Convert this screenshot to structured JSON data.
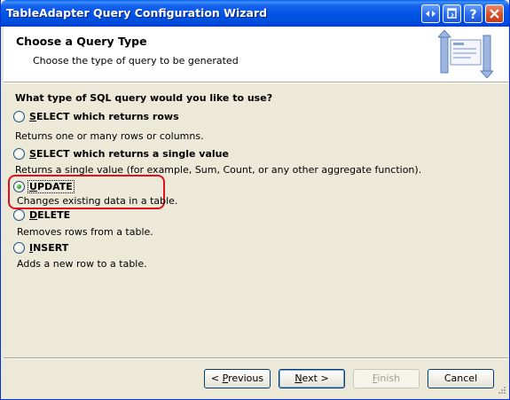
{
  "window": {
    "title": "TableAdapter Query Configuration Wizard"
  },
  "header": {
    "title": "Choose a Query Type",
    "subtitle": "Choose the type of query to be generated",
    "icon": "query-wizard-icon"
  },
  "question": "What type of SQL query would you like to use?",
  "options": [
    {
      "label_underlined": "S",
      "label_rest": "ELECT which returns rows",
      "description": "Returns one or many rows or columns.",
      "selected": false
    },
    {
      "label_underlined": "S",
      "label_rest": "ELECT which returns a single value",
      "description": "Returns a single value (for example, Sum, Count, or any other aggregate function).",
      "selected": false
    },
    {
      "label_underlined": "U",
      "label_rest": "PDATE",
      "description": "Changes existing data in a table.",
      "selected": true
    },
    {
      "label_underlined": "D",
      "label_rest": "ELETE",
      "description": "Removes rows from a table.",
      "selected": false
    },
    {
      "label_underlined": "I",
      "label_rest": "NSERT",
      "description": "Adds a new row to a table.",
      "selected": false
    }
  ],
  "buttons": {
    "previous_prefix": "< ",
    "previous_ul": "P",
    "previous_rest": "revious",
    "next_ul": "N",
    "next_rest": "ext >",
    "finish_ul": "F",
    "finish_rest": "inish",
    "cancel": "Cancel"
  },
  "colors": {
    "titlebar": "#0054e3",
    "highlight": "#e0101e",
    "dialog_bg": "#ece9d8"
  }
}
